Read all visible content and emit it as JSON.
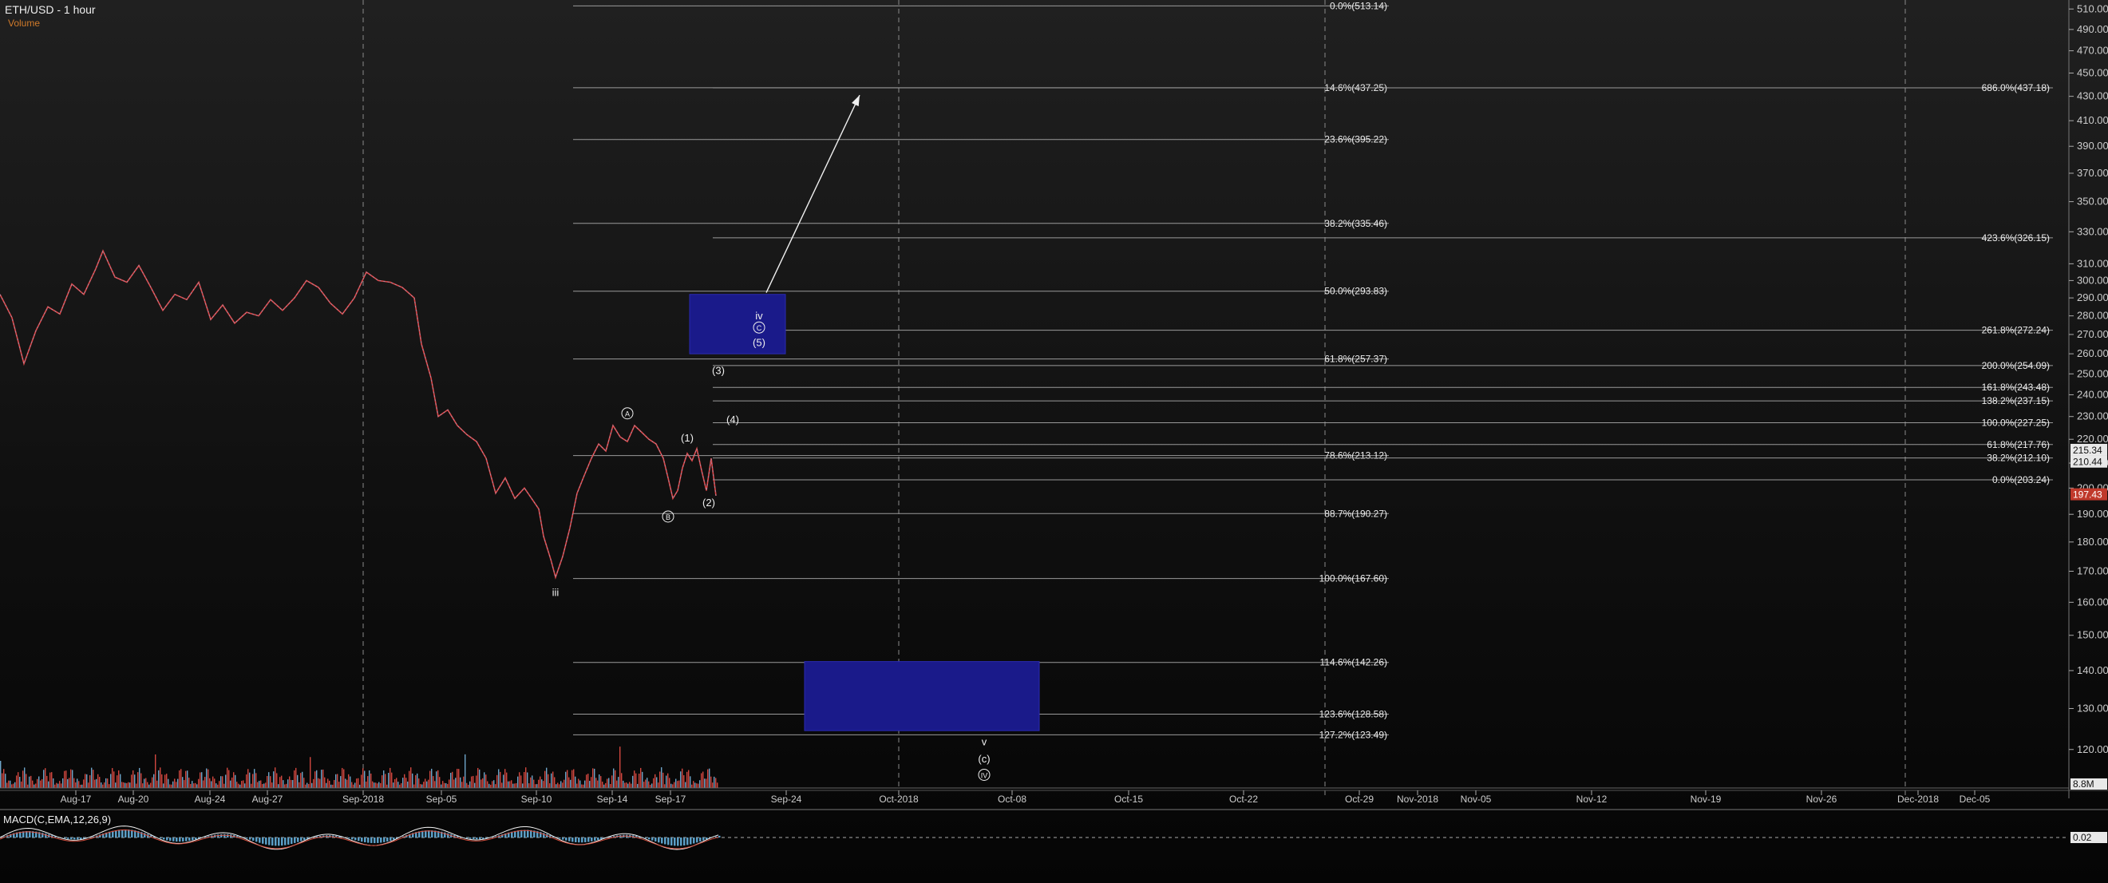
{
  "header": {
    "title": "ETH/USD - 1 hour",
    "volume_label": "Volume"
  },
  "macd": {
    "label": "MACD(C,EMA,12,26,9)",
    "value": "0.02"
  },
  "volume_axis": {
    "value": "8.8M"
  },
  "chart_data": {
    "type": "line",
    "symbol": "ETH/USD",
    "interval": "1 hour",
    "x_tick_labels": [
      "Aug-17",
      "Aug-20",
      "Aug-24",
      "Aug-27",
      "Sep-2018",
      "Sep-05",
      "Sep-10",
      "Sep-14",
      "Sep-17",
      "Sep-24",
      "Oct-2018",
      "Oct-08",
      "Oct-15",
      "Oct-22",
      "Oct-29",
      "Nov-2018",
      "Nov-05",
      "Nov-12",
      "Nov-19",
      "Nov-26",
      "Dec-2018",
      "Dec-05"
    ],
    "y_ticks": [
      120,
      130,
      140,
      150,
      160,
      170,
      180,
      190,
      200,
      210,
      220,
      230,
      240,
      250,
      260,
      270,
      280,
      290,
      300,
      310,
      330,
      350,
      370,
      390,
      410,
      430,
      450,
      470,
      490,
      510
    ],
    "y_tick_labels": [
      "120.00",
      "130.00",
      "140.00",
      "150.00",
      "160.00",
      "170.00",
      "180.00",
      "190.00",
      "200.00",
      "210.00",
      "220.00",
      "230.00",
      "240.00",
      "250.00",
      "260.00",
      "270.00",
      "280.00",
      "290.00",
      "300.00",
      "310.00",
      "330.00",
      "350.00",
      "370.00",
      "390.00",
      "410.00",
      "430.00",
      "450.00",
      "470.00",
      "490.00",
      "510.00"
    ],
    "ylim": [
      112,
      515
    ],
    "y_scale": "log",
    "price_markers": [
      {
        "value": 215.34,
        "label": "215.34"
      },
      {
        "value": 210.44,
        "label": "210.44"
      },
      {
        "value": 197.43,
        "label": "197.43"
      }
    ],
    "price_series": [
      {
        "x": 0,
        "y": 292
      },
      {
        "x": 0.5,
        "y": 279
      },
      {
        "x": 1,
        "y": 255
      },
      {
        "x": 1.5,
        "y": 272
      },
      {
        "x": 2,
        "y": 285
      },
      {
        "x": 2.5,
        "y": 281
      },
      {
        "x": 3,
        "y": 298
      },
      {
        "x": 3.5,
        "y": 292
      },
      {
        "x": 4,
        "y": 307
      },
      {
        "x": 4.3,
        "y": 318
      },
      {
        "x": 4.8,
        "y": 302
      },
      {
        "x": 5.3,
        "y": 299
      },
      {
        "x": 5.8,
        "y": 309
      },
      {
        "x": 6.3,
        "y": 296
      },
      {
        "x": 6.8,
        "y": 283
      },
      {
        "x": 7.3,
        "y": 292
      },
      {
        "x": 7.8,
        "y": 289
      },
      {
        "x": 8.3,
        "y": 299
      },
      {
        "x": 8.8,
        "y": 278
      },
      {
        "x": 9.3,
        "y": 286
      },
      {
        "x": 9.8,
        "y": 276
      },
      {
        "x": 10.3,
        "y": 282
      },
      {
        "x": 10.8,
        "y": 280
      },
      {
        "x": 11.3,
        "y": 289
      },
      {
        "x": 11.8,
        "y": 283
      },
      {
        "x": 12.3,
        "y": 290
      },
      {
        "x": 12.8,
        "y": 300
      },
      {
        "x": 13.3,
        "y": 296
      },
      {
        "x": 13.8,
        "y": 287
      },
      {
        "x": 14.3,
        "y": 281
      },
      {
        "x": 14.8,
        "y": 290
      },
      {
        "x": 15.3,
        "y": 305
      },
      {
        "x": 15.8,
        "y": 300
      },
      {
        "x": 16.3,
        "y": 299
      },
      {
        "x": 16.8,
        "y": 296
      },
      {
        "x": 17.3,
        "y": 290
      },
      {
        "x": 17.6,
        "y": 265
      },
      {
        "x": 18,
        "y": 248
      },
      {
        "x": 18.3,
        "y": 230
      },
      {
        "x": 18.7,
        "y": 233
      },
      {
        "x": 19.1,
        "y": 226
      },
      {
        "x": 19.5,
        "y": 222
      },
      {
        "x": 19.9,
        "y": 219
      },
      {
        "x": 20.3,
        "y": 212
      },
      {
        "x": 20.7,
        "y": 198
      },
      {
        "x": 21.1,
        "y": 204
      },
      {
        "x": 21.5,
        "y": 196
      },
      {
        "x": 21.9,
        "y": 200
      },
      {
        "x": 22.2,
        "y": 196
      },
      {
        "x": 22.5,
        "y": 192
      },
      {
        "x": 22.7,
        "y": 182
      },
      {
        "x": 23,
        "y": 174
      },
      {
        "x": 23.2,
        "y": 168
      },
      {
        "x": 23.5,
        "y": 175
      },
      {
        "x": 23.8,
        "y": 185
      },
      {
        "x": 24.1,
        "y": 198
      },
      {
        "x": 24.4,
        "y": 205
      },
      {
        "x": 24.7,
        "y": 212
      },
      {
        "x": 25,
        "y": 218
      },
      {
        "x": 25.3,
        "y": 215
      },
      {
        "x": 25.6,
        "y": 226
      },
      {
        "x": 25.9,
        "y": 221
      },
      {
        "x": 26.2,
        "y": 219
      },
      {
        "x": 26.5,
        "y": 226
      },
      {
        "x": 26.8,
        "y": 223
      },
      {
        "x": 27.1,
        "y": 220
      },
      {
        "x": 27.4,
        "y": 218
      },
      {
        "x": 27.7,
        "y": 212
      },
      {
        "x": 27.9,
        "y": 204
      },
      {
        "x": 28.1,
        "y": 196
      },
      {
        "x": 28.3,
        "y": 199
      },
      {
        "x": 28.5,
        "y": 208
      },
      {
        "x": 28.7,
        "y": 214
      },
      {
        "x": 28.9,
        "y": 211
      },
      {
        "x": 29.1,
        "y": 216
      },
      {
        "x": 29.3,
        "y": 207
      },
      {
        "x": 29.5,
        "y": 199
      },
      {
        "x": 29.7,
        "y": 212
      },
      {
        "x": 29.9,
        "y": 197
      }
    ],
    "fib_retracements_left": [
      {
        "label": "0.0%(513.14)",
        "value": 513.14
      },
      {
        "label": "14.6%(437.25)",
        "value": 437.25
      },
      {
        "label": "23.6%(395.22)",
        "value": 395.22
      },
      {
        "label": "38.2%(335.46)",
        "value": 335.46
      },
      {
        "label": "50.0%(293.83)",
        "value": 293.83
      },
      {
        "label": "61.8%(257.37)",
        "value": 257.37
      },
      {
        "label": "78.6%(213.12)",
        "value": 213.12
      },
      {
        "label": "88.7%(190.27)",
        "value": 190.27
      },
      {
        "label": "100.0%(167.60)",
        "value": 167.6
      },
      {
        "label": "114.6%(142.26)",
        "value": 142.26
      },
      {
        "label": "123.6%(128.58)",
        "value": 128.58
      },
      {
        "label": "127.2%(123.49)",
        "value": 123.49
      }
    ],
    "fib_extensions_right": [
      {
        "label": "686.0%(437.18)",
        "value": 437.18
      },
      {
        "label": "423.6%(326.15)",
        "value": 326.15
      },
      {
        "label": "261.8%(272.24)",
        "value": 272.24
      },
      {
        "label": "200.0%(254.09)",
        "value": 254.09
      },
      {
        "label": "161.8%(243.48)",
        "value": 243.48
      },
      {
        "label": "138.2%(237.15)",
        "value": 237.15
      },
      {
        "label": "100.0%(227.25)",
        "value": 227.25
      },
      {
        "label": "61.8%(217.76)",
        "value": 217.76
      },
      {
        "label": "38.2%(212.10)",
        "value": 212.1
      },
      {
        "label": "0.0%(203.24)",
        "value": 203.24
      }
    ],
    "wave_labels": [
      {
        "text": "iii",
        "x": 23.2,
        "y": 162,
        "circled": false
      },
      {
        "text": "A",
        "x": 26.2,
        "y": 230,
        "circled": true
      },
      {
        "text": "B",
        "x": 27.9,
        "y": 188,
        "circled": true
      },
      {
        "text": "(1)",
        "x": 28.7,
        "y": 219,
        "circled": false
      },
      {
        "text": "(2)",
        "x": 29.6,
        "y": 193,
        "circled": false
      },
      {
        "text": "(3)",
        "x": 30.0,
        "y": 250,
        "circled": false
      },
      {
        "text": "(4)",
        "x": 30.6,
        "y": 227,
        "circled": false
      },
      {
        "text": "iv",
        "x": 31.7,
        "y": 278,
        "circled": false
      },
      {
        "text": "C",
        "x": 31.7,
        "y": 272,
        "circled": true
      },
      {
        "text": "(5)",
        "x": 31.7,
        "y": 264,
        "circled": false
      },
      {
        "text": "v",
        "x": 41.1,
        "y": 121,
        "circled": false
      },
      {
        "text": "(c)",
        "x": 41.1,
        "y": 117,
        "circled": false
      },
      {
        "text": "IV",
        "x": 41.1,
        "y": 113.5,
        "circled": true
      }
    ],
    "target_boxes": [
      {
        "x0": 28.8,
        "x1": 32.8,
        "y_low": 260,
        "y_high": 292
      },
      {
        "x0": 33.6,
        "x1": 43.4,
        "y_low": 124.5,
        "y_high": 142.5
      }
    ],
    "projection_arrow": {
      "x0": 32.0,
      "y0": 293,
      "x1": 35.9,
      "y1": 431
    }
  }
}
